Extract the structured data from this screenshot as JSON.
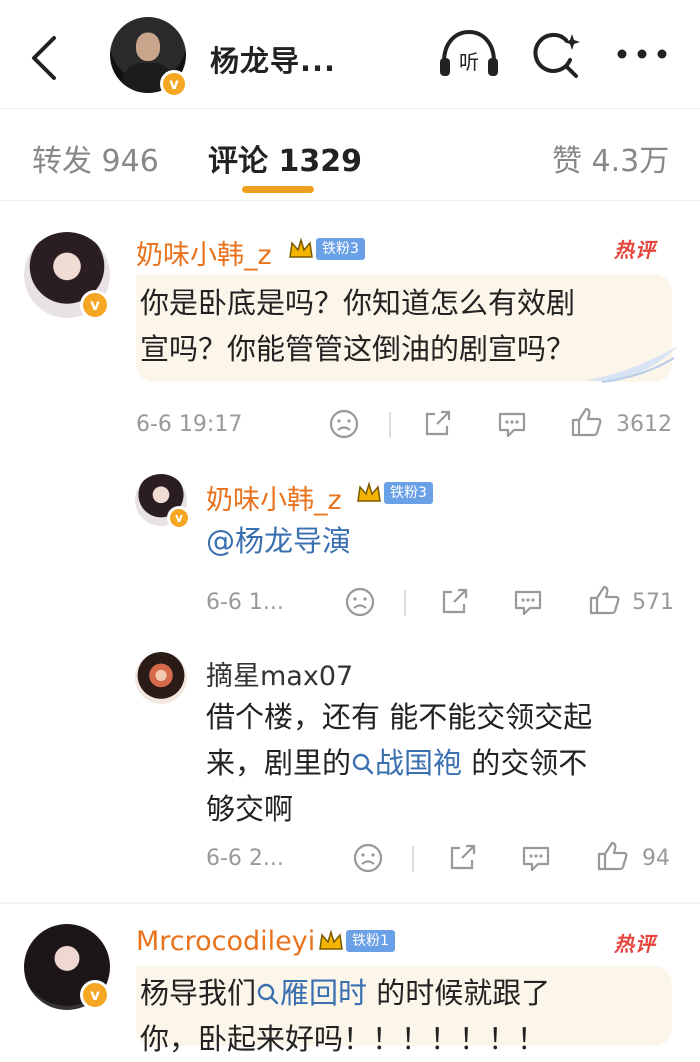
{
  "header": {
    "title": "杨龙导...",
    "back_icon": "chevron-left-icon",
    "listen_label": "听",
    "search_icon": "search-sparkle-icon",
    "more_icon": "ellipsis-icon"
  },
  "tabs": [
    {
      "label": "转发 946",
      "active": false
    },
    {
      "label": "评论 1329",
      "active": true
    },
    {
      "label": "赞 4.3万",
      "active": false
    }
  ],
  "colors": {
    "accent": "#f0a020",
    "username": "#e8731c",
    "link": "#3a6fb0",
    "hot": "#e6453d",
    "fan_badge": "#6aa0e6"
  },
  "comments": [
    {
      "user": "奶味小韩_z",
      "fan_badge": "铁粉3",
      "hot_label": "热评",
      "text_line1": "你是卧底是吗？你知道怎么有效剧",
      "text_line2": "宣吗？你能管管这倒油的剧宣吗？",
      "time": "6-6 19:17",
      "likes": "3612"
    },
    {
      "user": "奶味小韩_z",
      "fan_badge": "铁粉3",
      "text": "@杨龙导演",
      "time": "6-6 1...",
      "likes": "571"
    },
    {
      "user": "摘星max07",
      "text_line1": "借个楼，还有 能不能交领交起",
      "text_line2_a": "来，剧里的",
      "text_line2_link": "战国袍",
      "text_line2_b": " 的交领不",
      "text_line3": "够交啊",
      "time": "6-6 2...",
      "likes": "94"
    },
    {
      "user": "Mrcrocodileyi",
      "fan_badge": "铁粉1",
      "hot_label": "热评",
      "text_line1_a": "杨导我们",
      "text_line1_link": "雁回时",
      "text_line1_b": " 的时候就跟了",
      "text_line2": "你，卧起来好吗！！！！！！！"
    }
  ]
}
